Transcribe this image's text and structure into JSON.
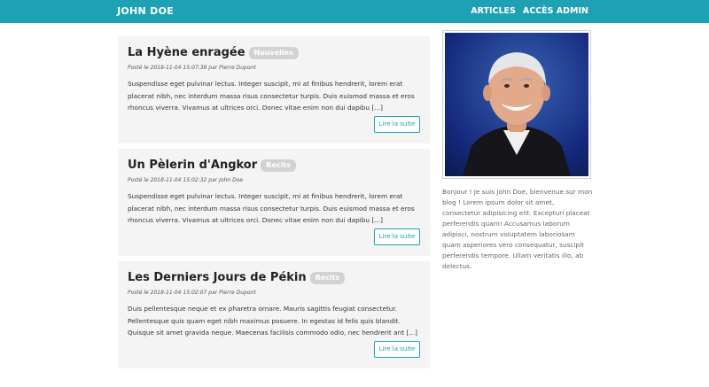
{
  "navbar": {
    "brand": "JOHN DOE",
    "links": [
      {
        "label": "ARTICLES"
      },
      {
        "label": "ACCÈS ADMIN"
      }
    ]
  },
  "posts": [
    {
      "title": "La Hyène enragée",
      "category": "Nouvelles",
      "meta": "Posté le 2018-11-04 15:07:38 par Pierre Dupont",
      "excerpt": "Suspendisse eget pulvinar lectus. Integer suscipit, mi at finibus hendrerit, lorem erat placerat nibh, nec interdum massa risus consectetur turpis. Duis euismod massa et eros rhoncus viverra. Vivamus at ultrices orci. Donec vitae enim non dui dapibu [...]",
      "more_label": "Lire la suite"
    },
    {
      "title": "Un Pèlerin d'Angkor",
      "category": "Recits",
      "meta": "Posté le 2018-11-04 15:02:32 par John Doe",
      "excerpt": "Suspendisse eget pulvinar lectus. Integer suscipit, mi at finibus hendrerit, lorem erat placerat nibh, nec interdum massa risus consectetur turpis. Duis euismod massa et eros rhoncus viverra. Vivamus at ultrices orci. Donec vitae enim non dui dapibu [...]",
      "more_label": "Lire la suite"
    },
    {
      "title": "Les Derniers Jours de Pékin",
      "category": "Recits",
      "meta": "Posté le 2018-11-04 15:02:07 par Pierre Dupont",
      "excerpt": "Duis pellentesque neque et ex pharetra ornare. Mauris sagittis feugiat consectetur. Pellentesque quis quam eget nibh maximus posuere. In egestas id felis quis blandit. Quisque sit amet gravida neque. Maecenas facilisis commodo odio, nec hendrerit ant [...]",
      "more_label": "Lire la suite"
    }
  ],
  "sidebar": {
    "bio": "Bonjour ! Je suis John Doe, bienvenue sur mon blog ! Lorem ipsum dolor sit amet, consectetur adipisicing elit. Excepturi placeat perferendis quam! Accusamus laborum adipisci, nostrum voluptatem laboriosam quam asperiores vero consequatur, suscipit perferendis tempore. Ullam veritatis illo, ab delectus."
  },
  "colors": {
    "accent": "#1ea1b5",
    "card_bg": "#f4f4f5",
    "badge_bg": "#d2d2d2"
  }
}
